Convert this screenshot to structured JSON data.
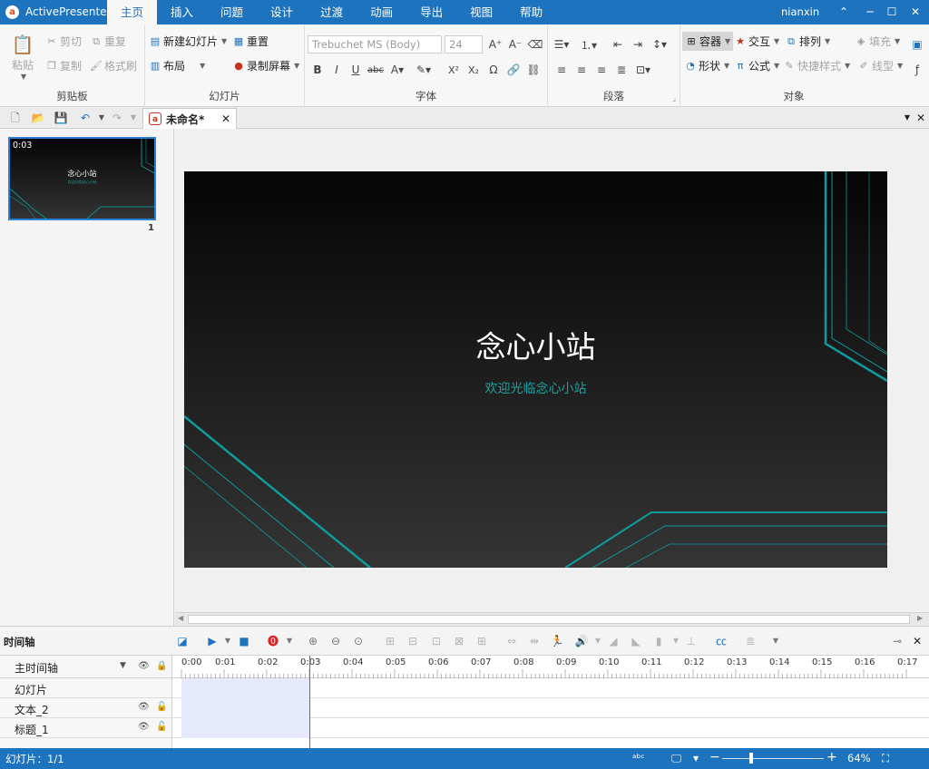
{
  "app": {
    "name": "ActivePresenter",
    "user": "nianxin"
  },
  "menu_tabs": [
    "主页",
    "插入",
    "问题",
    "设计",
    "过渡",
    "动画",
    "导出",
    "视图",
    "帮助"
  ],
  "ribbon": {
    "clipboard": {
      "paste": "粘贴",
      "cut": "剪切",
      "copy": "复制",
      "duplicate": "重复",
      "format_painter": "格式刷",
      "label": "剪贴板"
    },
    "slides": {
      "new_slide": "新建幻灯片",
      "reset": "重置",
      "layout": "布局",
      "record_screen": "录制屏幕",
      "label": "幻灯片"
    },
    "font": {
      "font_name": "Trebuchet MS (Body)",
      "font_size": "24",
      "label": "字体"
    },
    "paragraph": {
      "label": "段落"
    },
    "objects": {
      "container": "容器",
      "interaction": "交互",
      "arrange": "排列",
      "fill": "填充",
      "shape": "形状",
      "equation": "公式",
      "quick_style": "快捷样式",
      "line_style": "线型",
      "label": "对象"
    }
  },
  "document": {
    "tab_title": "未命名*"
  },
  "slide_panel": {
    "thumb_time": "0:03",
    "thumb_number": "1"
  },
  "slide": {
    "title": "念心小站",
    "subtitle": "欢迎光临念心小站"
  },
  "timeline": {
    "label": "时间轴",
    "main_timeline": "主时间轴",
    "ticks": [
      "0:00",
      "0:01",
      "0:02",
      "0:03",
      "0:04",
      "0:05",
      "0:06",
      "0:07",
      "0:08",
      "0:09",
      "0:10",
      "0:11",
      "0:12",
      "0:13",
      "0:14",
      "0:15",
      "0:16",
      "0:17"
    ],
    "layers": [
      "幻灯片",
      "文本_2",
      "标题_1"
    ]
  },
  "status": {
    "slide_counter": "幻灯片：1/1",
    "zoom": "64%"
  }
}
